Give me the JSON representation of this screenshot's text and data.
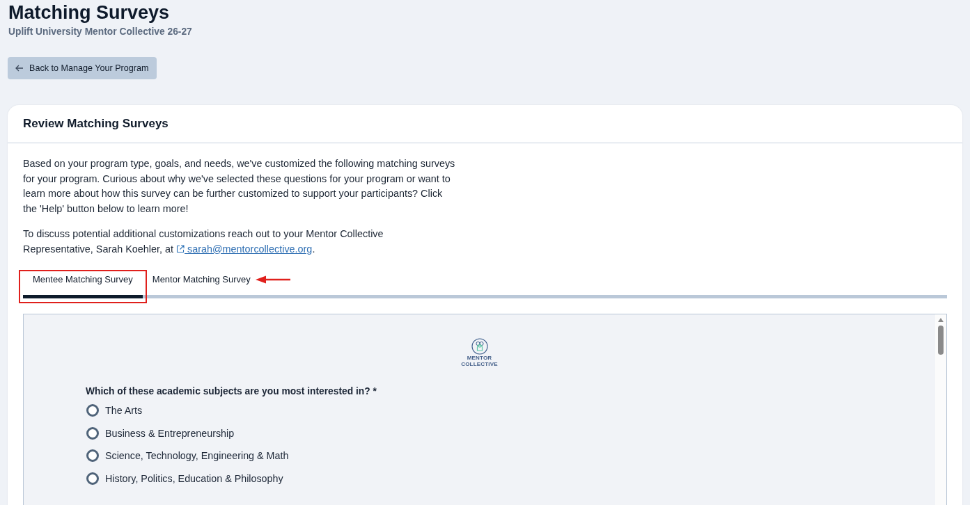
{
  "header": {
    "title": "Matching Surveys",
    "subtitle": "Uplift University Mentor Collective 26-27"
  },
  "back_button": {
    "label": "Back to Manage Your Program"
  },
  "card": {
    "title": "Review Matching Surveys",
    "intro": "Based on your program type, goals, and needs, we've customized the following matching surveys for your program. Curious about why we've selected these questions for your program or want to learn more about how this survey can be further customized to support your participants? Click the 'Help' button below to learn more!",
    "contact": {
      "text": "To discuss potential additional customizations reach out to your Mentor Collective Representative, Sarah Koehler, at ",
      "link": "sarah@mentorcollective.org",
      "after": "."
    },
    "tabs": [
      {
        "label": "Mentee Matching Survey",
        "selected": true,
        "outlined": true,
        "pointed_at": false
      },
      {
        "label": "Mentor Matching Survey",
        "selected": false,
        "outlined": false,
        "pointed_at": true
      }
    ],
    "survey": {
      "logo": {
        "line_1": "MENTOR",
        "line_2": "COLLECTIVE"
      },
      "question": {
        "text": "Which of these academic subjects are you most interested in?",
        "required_mark": "*"
      },
      "options": [
        {
          "label": "The Arts",
          "selected": false
        },
        {
          "label": "Business & Entrepreneurship",
          "selected": false
        },
        {
          "label": "Science, Technology, Engineering & Math",
          "selected": false
        },
        {
          "label": "History, Politics, Education & Philosophy",
          "selected": false
        }
      ]
    }
  }
}
